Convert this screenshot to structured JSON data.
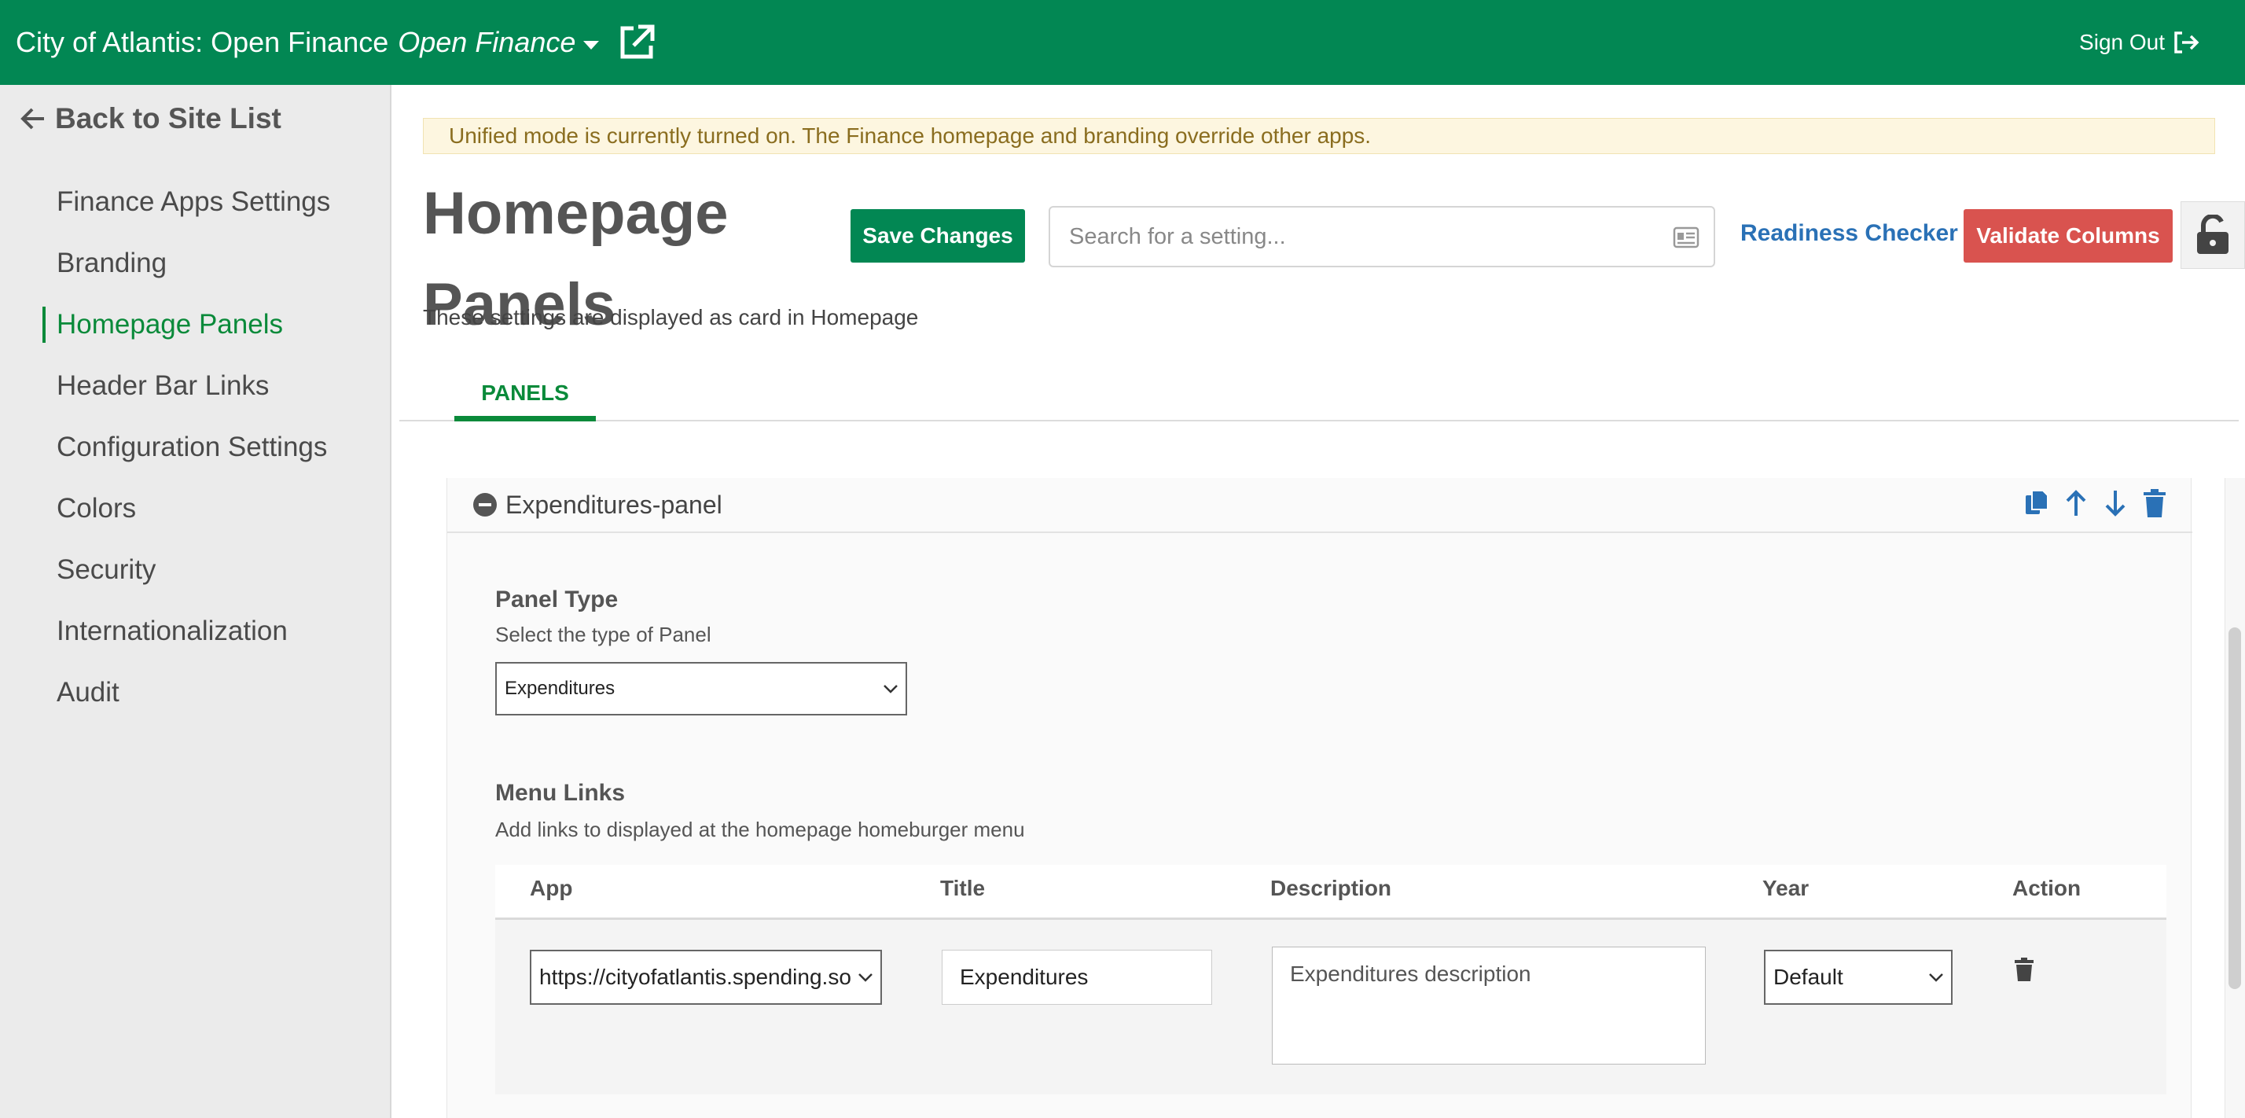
{
  "header": {
    "site_title": "City of Atlantis: Open Finance",
    "app_name": "Open Finance",
    "sign_out": "Sign Out"
  },
  "sidebar": {
    "back_label": "Back to Site List",
    "items": [
      {
        "label": "Finance Apps Settings"
      },
      {
        "label": "Branding"
      },
      {
        "label": "Homepage Panels",
        "active": true
      },
      {
        "label": "Header Bar Links"
      },
      {
        "label": "Configuration Settings"
      },
      {
        "label": "Colors"
      },
      {
        "label": "Security"
      },
      {
        "label": "Internationalization"
      },
      {
        "label": "Audit"
      }
    ]
  },
  "banner": "Unified mode is currently turned on. The Finance homepage and branding override other apps.",
  "page": {
    "title": "Homepage Panels",
    "subtitle": "These settings are displayed as card in Homepage"
  },
  "toolbar": {
    "save_label": "Save Changes",
    "search_placeholder": "Search for a setting...",
    "readiness_label": "Readiness Checker",
    "validate_label": "Validate Columns"
  },
  "tabs": [
    {
      "label": "PANELS"
    }
  ],
  "panel": {
    "title": "Expenditures-panel",
    "panel_type": {
      "label": "Panel Type",
      "help": "Select the type of Panel",
      "value": "Expenditures"
    },
    "menu_links": {
      "label": "Menu Links",
      "help": "Add links to displayed at the homepage homeburger menu",
      "columns": [
        "App",
        "Title",
        "Description",
        "Year",
        "Action"
      ],
      "rows": [
        {
          "app": "https://cityofatlantis.spending.socrata.com",
          "title": "Expenditures",
          "description": "Expenditures description",
          "year": "Default"
        }
      ]
    }
  },
  "colors": {
    "brand_green": "#028753",
    "link_blue": "#2a71b6",
    "danger_red": "#d9534f",
    "active_nav": "#0a8a3a"
  }
}
